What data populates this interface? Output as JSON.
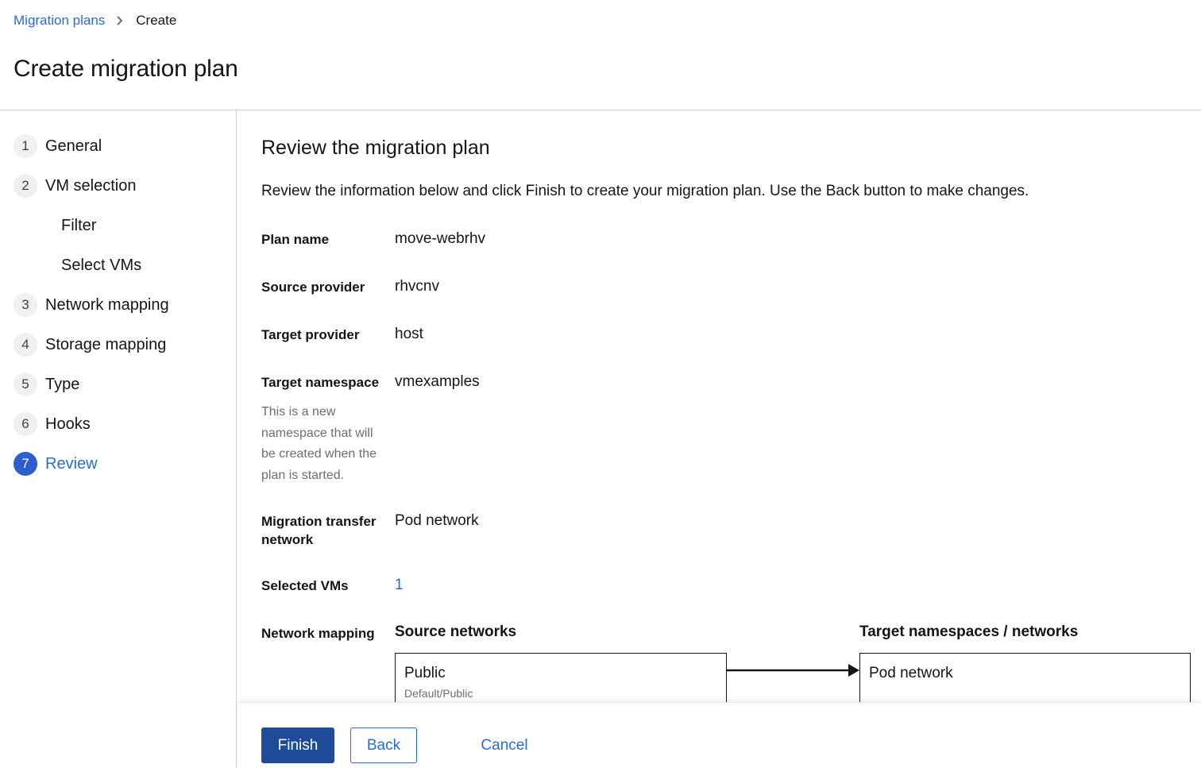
{
  "breadcrumb": {
    "parent": "Migration plans",
    "current": "Create"
  },
  "page": {
    "title": "Create migration plan"
  },
  "wizard": {
    "steps": [
      {
        "num": "1",
        "label": "General"
      },
      {
        "num": "2",
        "label": "VM selection"
      },
      {
        "num": "",
        "label": "Filter"
      },
      {
        "num": "",
        "label": "Select VMs"
      },
      {
        "num": "3",
        "label": "Network mapping"
      },
      {
        "num": "4",
        "label": "Storage mapping"
      },
      {
        "num": "5",
        "label": "Type"
      },
      {
        "num": "6",
        "label": "Hooks"
      },
      {
        "num": "7",
        "label": "Review"
      }
    ],
    "active_step": "Review"
  },
  "review": {
    "title": "Review the migration plan",
    "intro": "Review the information below and click Finish to create your migration plan. Use the Back button to make changes.",
    "plan_name": {
      "label": "Plan name",
      "value": "move-webrhv"
    },
    "source_provider": {
      "label": "Source provider",
      "value": "rhvcnv"
    },
    "target_provider": {
      "label": "Target provider",
      "value": "host"
    },
    "target_namespace": {
      "label": "Target namespace",
      "value": "vmexamples",
      "help": "This is a new namespace that will be created when the plan is started."
    },
    "transfer_network": {
      "label": "Migration transfer network",
      "value": "Pod network"
    },
    "selected_vms": {
      "label": "Selected VMs",
      "value": "1"
    },
    "network_mapping": {
      "label": "Network mapping",
      "source_header": "Source networks",
      "target_header": "Target namespaces / networks",
      "rows": [
        {
          "source_name": "Public",
          "source_path": "Default/Public",
          "target": "Pod network"
        }
      ]
    }
  },
  "footer": {
    "finish": "Finish",
    "back": "Back",
    "cancel": "Cancel"
  },
  "colors": {
    "link": "#2b6bd1",
    "primary_button": "#1e4b9a",
    "active_step": "#2b5fce"
  }
}
